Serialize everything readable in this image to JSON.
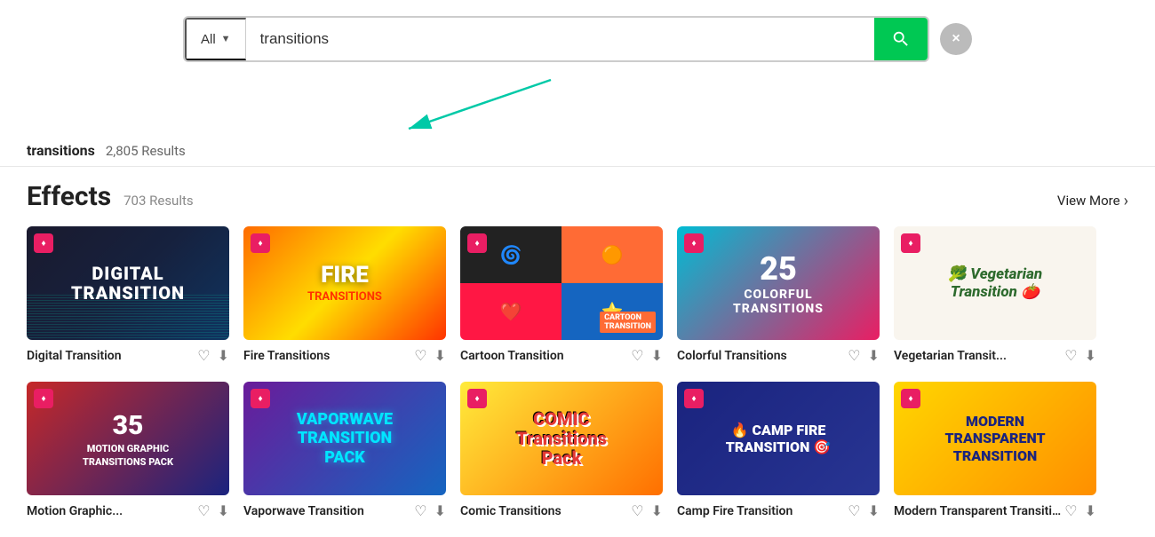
{
  "search": {
    "category_label": "All",
    "query": "transitions",
    "search_button_label": "Search",
    "close_button_label": "×"
  },
  "results": {
    "query_label": "transitions",
    "total_count": "2,805 Results"
  },
  "effects_section": {
    "title": "Effects",
    "count": "703 Results",
    "view_more": "View More"
  },
  "effects_row1": [
    {
      "id": "digital-transition",
      "title": "Digital Transition",
      "thumb_type": "digital",
      "thumb_text_line1": "DIGITAL",
      "thumb_text_line2": "TRANSITION"
    },
    {
      "id": "fire-transitions",
      "title": "Fire Transitions",
      "thumb_type": "fire",
      "thumb_text_line1": "FIRE",
      "thumb_text_line2": "TRANSITIONS"
    },
    {
      "id": "cartoon-transition",
      "title": "Cartoon Transition",
      "thumb_type": "cartoon",
      "thumb_text": "CARTOON TRANSITION"
    },
    {
      "id": "colorful-transitions",
      "title": "Colorful Transitions",
      "thumb_type": "colorful",
      "thumb_num": "25",
      "thumb_text_line1": "COLORFUL",
      "thumb_text_line2": "TRANSITIONS"
    },
    {
      "id": "vegetarian-transition",
      "title": "Vegetarian Transit...",
      "thumb_type": "vegetarian",
      "thumb_text": "Vegetarian Transition"
    }
  ],
  "effects_row2": [
    {
      "id": "motion-pack",
      "title": "Motion Graphic...",
      "thumb_type": "motion",
      "thumb_num": "35",
      "thumb_text": "MOTION GRAPHIC TRANSITIONS PACK"
    },
    {
      "id": "vaporwave-transition",
      "title": "Vaporwave Transition",
      "thumb_type": "vaporwave",
      "thumb_text_line1": "VAPORWAVE",
      "thumb_text_line2": "TRANSITION",
      "thumb_text_line3": "PACK"
    },
    {
      "id": "comic-transitions",
      "title": "Comic Transitions",
      "thumb_type": "comic",
      "thumb_text_line1": "COMIC",
      "thumb_text_line2": "Transitions",
      "thumb_text_line3": "Pack"
    },
    {
      "id": "campfire-transition",
      "title": "Camp Fire Transition",
      "thumb_type": "campfire",
      "thumb_text_line1": "CAMP FIRE",
      "thumb_text_line2": "TRANSITION"
    },
    {
      "id": "modern-transition",
      "title": "Modern Transparent Transition",
      "thumb_type": "modern",
      "thumb_text_line1": "MODERN",
      "thumb_text_line2": "TRANSPARENT",
      "thumb_text_line3": "TRANSITION"
    }
  ]
}
